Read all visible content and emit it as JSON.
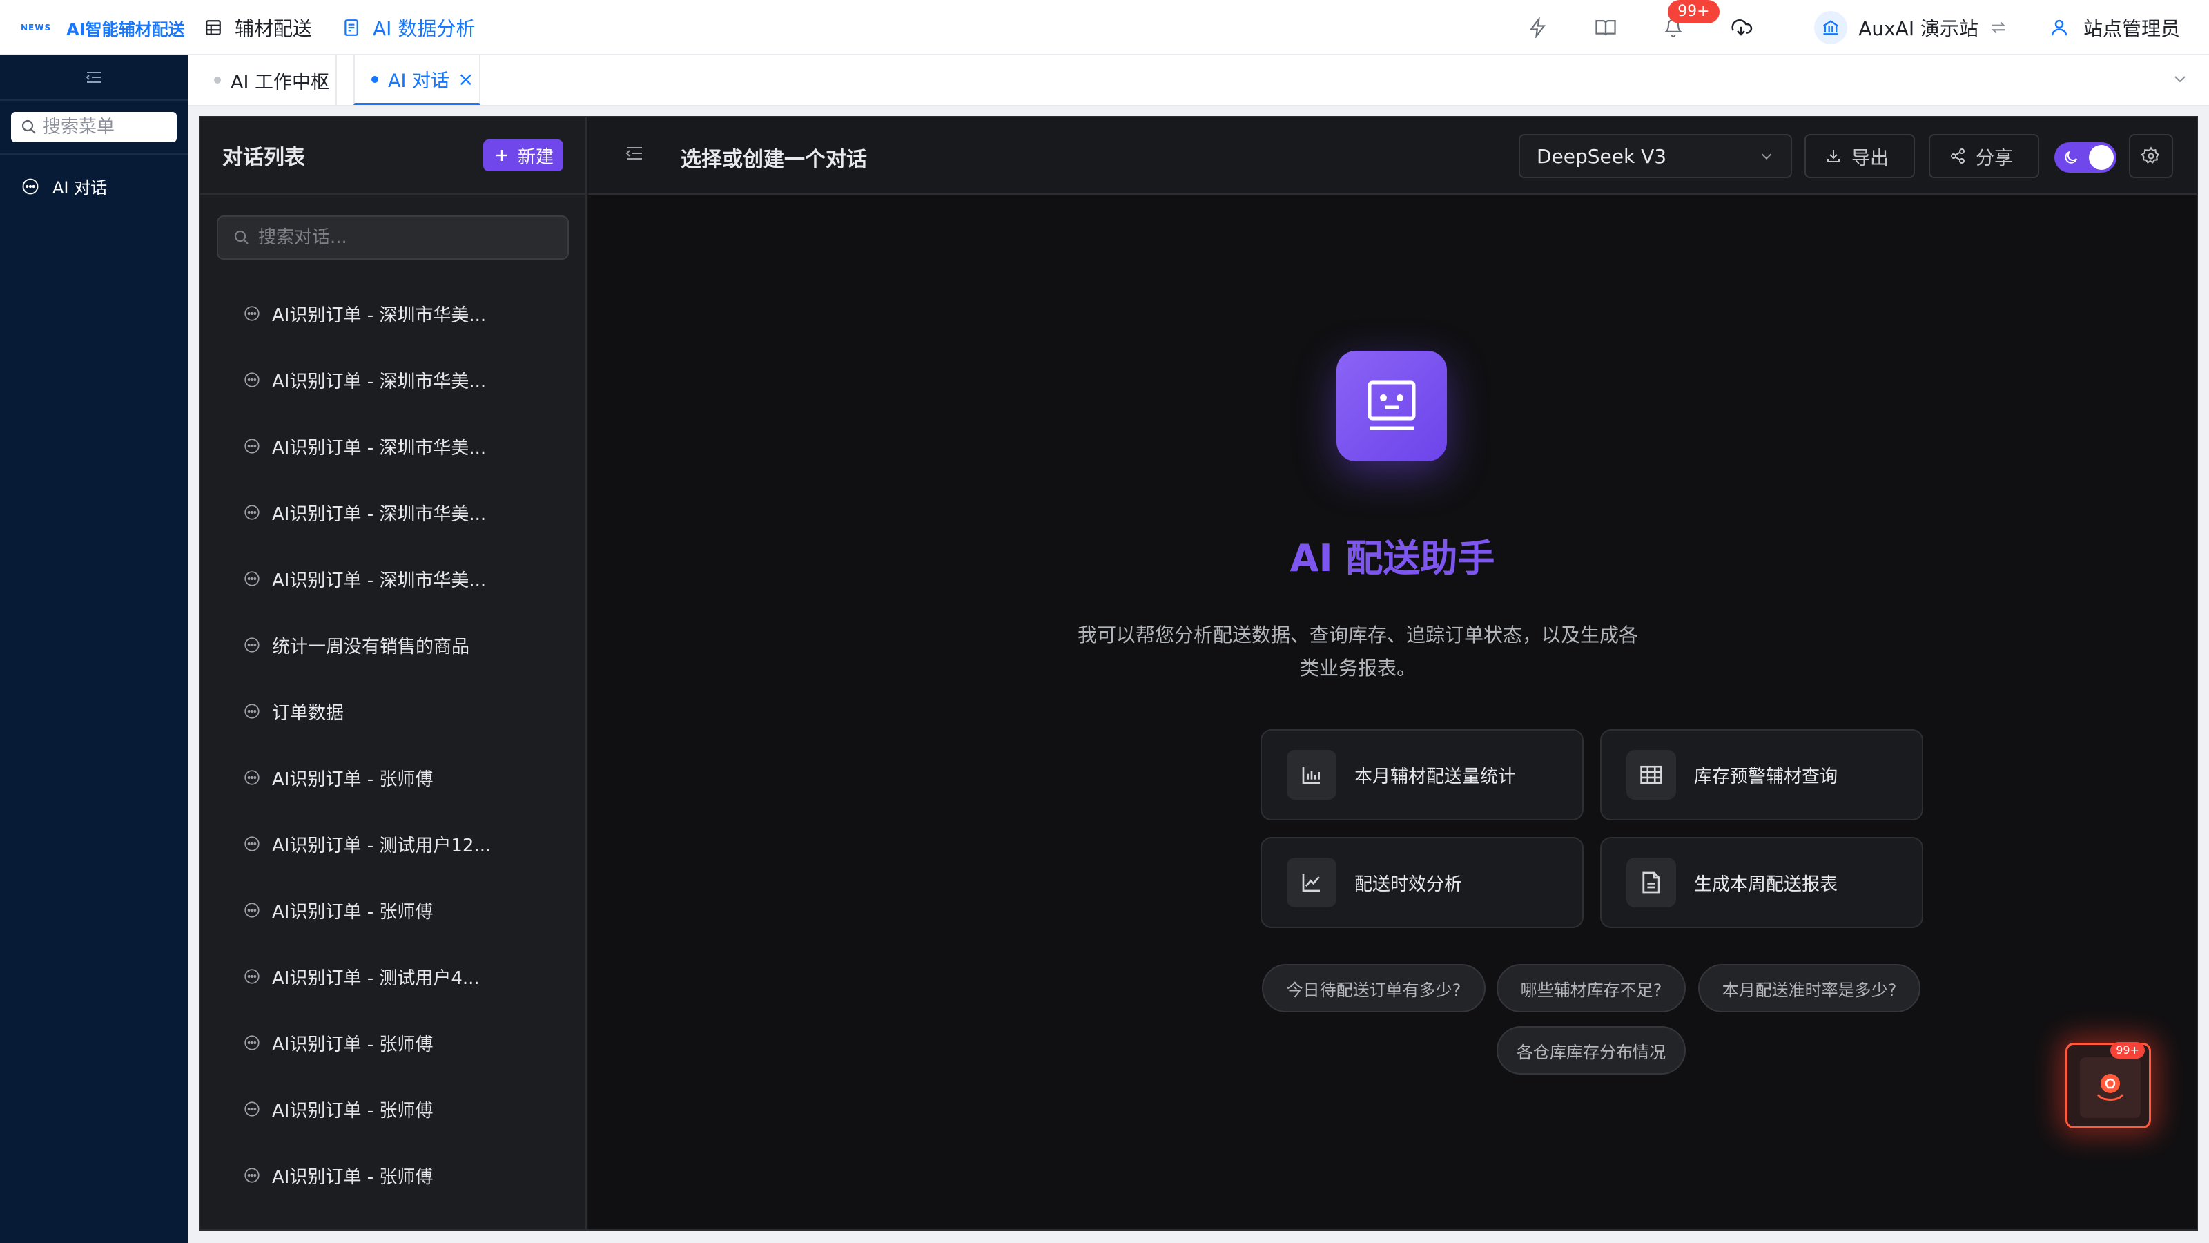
{
  "app": {
    "logo_mark": "NEWS",
    "title": "AI智能辅材配送"
  },
  "topnav": [
    {
      "label": "辅材配送",
      "icon": "table-icon",
      "active": false
    },
    {
      "label": "AI 数据分析",
      "icon": "report-icon",
      "active": true
    }
  ],
  "header": {
    "notifications_badge": "99+",
    "site_name": "AuxAI 演示站",
    "user_name": "站点管理员"
  },
  "sidebar": {
    "search_placeholder": "搜索菜单",
    "items": [
      {
        "label": "AI 对话",
        "icon": "chat-bubble-icon"
      }
    ]
  },
  "tabs": [
    {
      "label": "AI 工作中枢",
      "active": false
    },
    {
      "label": "AI 对话",
      "active": true,
      "closable": true
    }
  ],
  "conversations": {
    "title": "对话列表",
    "new_label": "新建",
    "search_placeholder": "搜索对话...",
    "items": [
      "AI识别订单 - 深圳市华美...",
      "AI识别订单 - 深圳市华美...",
      "AI识别订单 - 深圳市华美...",
      "AI识别订单 - 深圳市华美...",
      "AI识别订单 - 深圳市华美...",
      "统计一周没有销售的商品",
      "订单数据",
      "AI识别订单 - 张师傅",
      "AI识别订单 - 测试用户12...",
      "AI识别订单 - 张师傅",
      "AI识别订单 - 测试用户4...",
      "AI识别订单 - 张师傅",
      "AI识别订单 - 张师傅",
      "AI识别订单 - 张师傅"
    ]
  },
  "chat": {
    "title": "选择或创建一个对话",
    "model": "DeepSeek V3",
    "export_label": "导出",
    "share_label": "分享",
    "dark_mode": true,
    "hero_title": "AI 配送助手",
    "hero_desc": "我可以帮您分析配送数据、查询库存、追踪订单状态，以及生成各类业务报表。",
    "actions": [
      {
        "label": "本月辅材配送量统计",
        "icon": "bar-chart-icon"
      },
      {
        "label": "库存预警辅材查询",
        "icon": "table-grid-icon"
      },
      {
        "label": "配送时效分析",
        "icon": "line-chart-icon"
      },
      {
        "label": "生成本周配送报表",
        "icon": "document-icon"
      }
    ],
    "suggestions": [
      "今日待配送订单有多少?",
      "哪些辅材库存不足?",
      "本月配送准时率是多少?",
      "各仓库库存分布情况"
    ]
  },
  "floating": {
    "badge": "99+",
    "icon": "bulb-icon"
  },
  "colors": {
    "brand_blue": "#1677ff",
    "accent_purple": "#7047eb",
    "sidebar_bg": "#071a36",
    "panel_bg": "#161719"
  }
}
